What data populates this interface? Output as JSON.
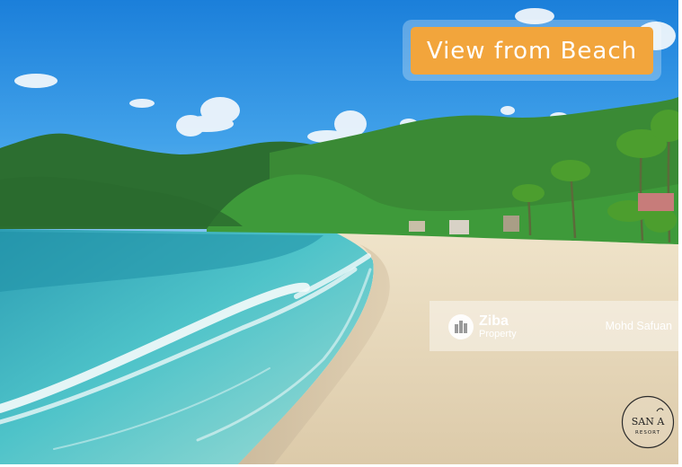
{
  "caption": {
    "text": "View from Beach",
    "background": "#F2A53C"
  },
  "watermark": {
    "brand": "Ziba",
    "brand_sub": "Property",
    "agent": "Mohd Safuan"
  },
  "resort_logo": {
    "text": "SAN A RESORT"
  },
  "colors": {
    "sky": "#2E8FE0",
    "sea": "#3FB7C4",
    "sand": "#E8D9BE",
    "forest": "#2F7A35"
  }
}
